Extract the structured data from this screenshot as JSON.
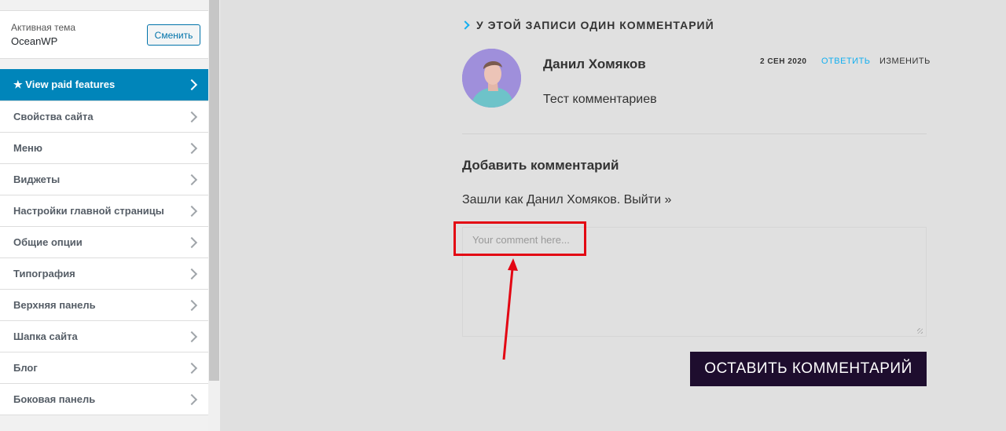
{
  "sidebar": {
    "active_theme_label": "Активная тема",
    "theme_name": "OceanWP",
    "change_button": "Сменить",
    "items": [
      {
        "label": "★ View paid features"
      },
      {
        "label": "Свойства сайта"
      },
      {
        "label": "Меню"
      },
      {
        "label": "Виджеты"
      },
      {
        "label": "Настройки главной страницы"
      },
      {
        "label": "Общие опции"
      },
      {
        "label": "Типография"
      },
      {
        "label": "Верхняя панель"
      },
      {
        "label": "Шапка сайта"
      },
      {
        "label": "Блог"
      },
      {
        "label": "Боковая панель"
      }
    ]
  },
  "comments": {
    "title": "У ЭТОЙ ЗАПИСИ ОДИН КОММЕНТАРИЙ",
    "author": "Данил Хомяков",
    "date": "2 СЕН 2020",
    "reply": "ОТВЕТИТЬ",
    "edit": "ИЗМЕНИТЬ",
    "text": "Тест комментариев"
  },
  "form": {
    "title": "Добавить комментарий",
    "logged_in_prefix": "Зашли как ",
    "logged_in_user": "Данил Хомяков",
    "logged_in_sep": ". ",
    "logout": "Выйти »",
    "placeholder": "Your comment here...",
    "submit": "ОСТАВИТЬ КОММЕНТАРИЙ"
  },
  "colors": {
    "accent": "#13aff0",
    "paid_bg": "#0085ba",
    "submit_bg": "#1e0d2e",
    "annotation": "#e30613"
  }
}
